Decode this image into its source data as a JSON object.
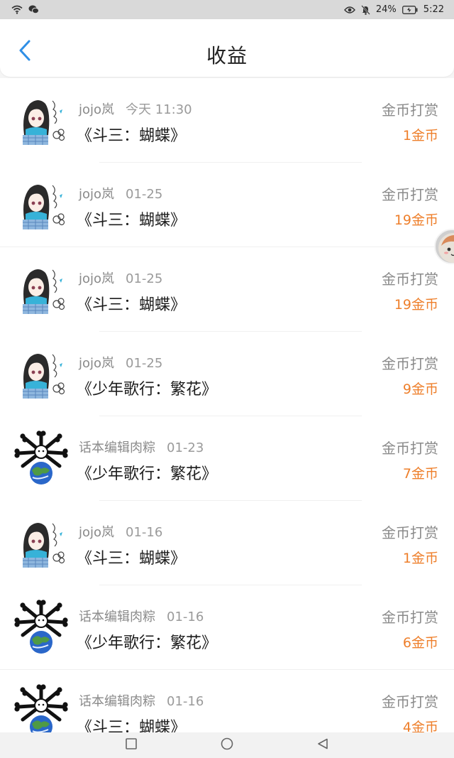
{
  "status_bar": {
    "battery": "24%",
    "time": "5:22"
  },
  "header": {
    "title": "收益"
  },
  "records": [
    {
      "user": "jojo岚",
      "time": "今天 11:30",
      "book": "《斗三：蝴蝶》",
      "type": "金币打赏",
      "amount": "1金币",
      "avatar": "anime-girl"
    },
    {
      "user": "jojo岚",
      "time": "01-25",
      "book": "《斗三：蝴蝶》",
      "type": "金币打赏",
      "amount": "19金币",
      "avatar": "anime-girl"
    },
    {
      "user": "jojo岚",
      "time": "01-25",
      "book": "《斗三：蝴蝶》",
      "type": "金币打赏",
      "amount": "19金币",
      "avatar": "anime-girl"
    },
    {
      "user": "jojo岚",
      "time": "01-25",
      "book": "《少年歌行：繁花》",
      "type": "金币打赏",
      "amount": "9金币",
      "avatar": "anime-girl"
    },
    {
      "user": "话本编辑肉粽",
      "time": "01-23",
      "book": "《少年歌行：繁花》",
      "type": "金币打赏",
      "amount": "7金币",
      "avatar": "earth-bones"
    },
    {
      "user": "jojo岚",
      "time": "01-16",
      "book": "《斗三：蝴蝶》",
      "type": "金币打赏",
      "amount": "1金币",
      "avatar": "anime-girl"
    },
    {
      "user": "话本编辑肉粽",
      "time": "01-16",
      "book": "《少年歌行：繁花》",
      "type": "金币打赏",
      "amount": "6金币",
      "avatar": "earth-bones"
    },
    {
      "user": "话本编辑肉粽",
      "time": "01-16",
      "book": "《斗三：蝴蝶》",
      "type": "金币打赏",
      "amount": "4金币",
      "avatar": "earth-bones"
    }
  ],
  "colors": {
    "accent": "#2f8fe6",
    "amount": "#ee7f2b",
    "muted": "#8a8a8a"
  },
  "icons": {
    "back": "chevron-left-icon",
    "nav": [
      "recent-apps-icon",
      "home-icon",
      "back-triangle-icon"
    ]
  }
}
